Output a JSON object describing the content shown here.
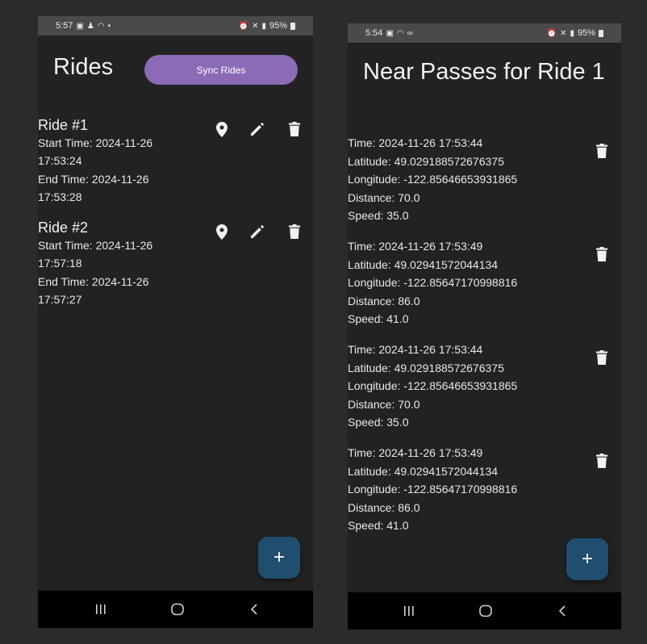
{
  "left": {
    "status": {
      "time": "5:57",
      "battery": "95%"
    },
    "title": "Rides",
    "sync_label": "Sync Rides",
    "rides": [
      {
        "title": "Ride #1",
        "start_label": "Start Time: 2024-11-26",
        "start_time": "17:53:24",
        "end_label": "End Time: 2024-11-26",
        "end_time": "17:53:28"
      },
      {
        "title": "Ride #2",
        "start_label": "Start Time: 2024-11-26",
        "start_time": "17:57:18",
        "end_label": "End Time: 2024-11-26",
        "end_time": "17:57:27"
      }
    ],
    "fab_label": "+"
  },
  "right": {
    "status": {
      "time": "5:54",
      "battery": "95%"
    },
    "title": "Near Passes for Ride 1",
    "passes": [
      {
        "time": "Time: 2024-11-26 17:53:44",
        "latitude": "Latitude: 49.029188572676375",
        "longitude": "Longitude: -122.85646653931865",
        "distance": "Distance: 70.0",
        "speed": "Speed: 35.0"
      },
      {
        "time": "Time: 2024-11-26 17:53:49",
        "latitude": "Latitude: 49.02941572044134",
        "longitude": "Longitude: -122.85647170998816",
        "distance": "Distance: 86.0",
        "speed": "Speed: 41.0"
      },
      {
        "time": "Time: 2024-11-26 17:53:44",
        "latitude": "Latitude: 49.029188572676375",
        "longitude": "Longitude: -122.85646653931865",
        "distance": "Distance: 70.0",
        "speed": "Speed: 35.0"
      },
      {
        "time": "Time: 2024-11-26 17:53:49",
        "latitude": "Latitude: 49.02941572044134",
        "longitude": "Longitude: -122.85647170998816",
        "distance": "Distance: 86.0",
        "speed": "Speed: 41.0"
      }
    ],
    "fab_label": "+"
  },
  "icons": {
    "location": "location-pin-icon",
    "edit": "pencil-icon",
    "delete": "trash-icon",
    "add": "plus-icon",
    "nav_recents": "recents-icon",
    "nav_home": "home-icon",
    "nav_back": "back-icon"
  },
  "colors": {
    "background": "#222222",
    "accent": "#8b6bb5",
    "fab": "#1f4e6e",
    "statusbar": "#4a4a4a",
    "navbar": "#000000"
  }
}
